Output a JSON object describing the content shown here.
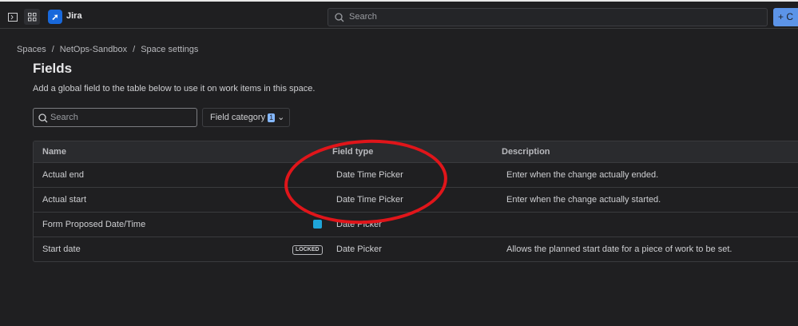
{
  "topbar": {
    "app_name": "Jira",
    "search_placeholder": "Search",
    "create_label": "C",
    "icons": [
      "sidebar-toggle-icon",
      "app-switcher-icon",
      "jira-logo",
      "search-icon",
      "plus-icon"
    ]
  },
  "breadcrumb": [
    "Spaces",
    "NetOps-Sandbox",
    "Space settings"
  ],
  "page": {
    "title": "Fields",
    "subtitle": "Add a global field to the table below to use it on work items in this space."
  },
  "filters": {
    "search_placeholder": "Search",
    "category_label": "Field category",
    "category_count": "1"
  },
  "table": {
    "headers": [
      "Name",
      "Field type",
      "Description"
    ],
    "rows": [
      {
        "name": "Actual end",
        "type": "Date Time Picker",
        "description": "Enter when the change actually ended.",
        "tag": ""
      },
      {
        "name": "Actual start",
        "type": "Date Time Picker",
        "description": "Enter when the change actually started.",
        "tag": ""
      },
      {
        "name": "Form Proposed Date/Time",
        "type": "Date Picker",
        "description": "",
        "tag": "app-icon"
      },
      {
        "name": "Start date",
        "type": "Date Picker",
        "description": "Allows the planned start date for a piece of work to be set.",
        "tag": "LOCKED"
      }
    ]
  },
  "annotation": {
    "color": "#e0151a",
    "shape": "ellipse"
  }
}
